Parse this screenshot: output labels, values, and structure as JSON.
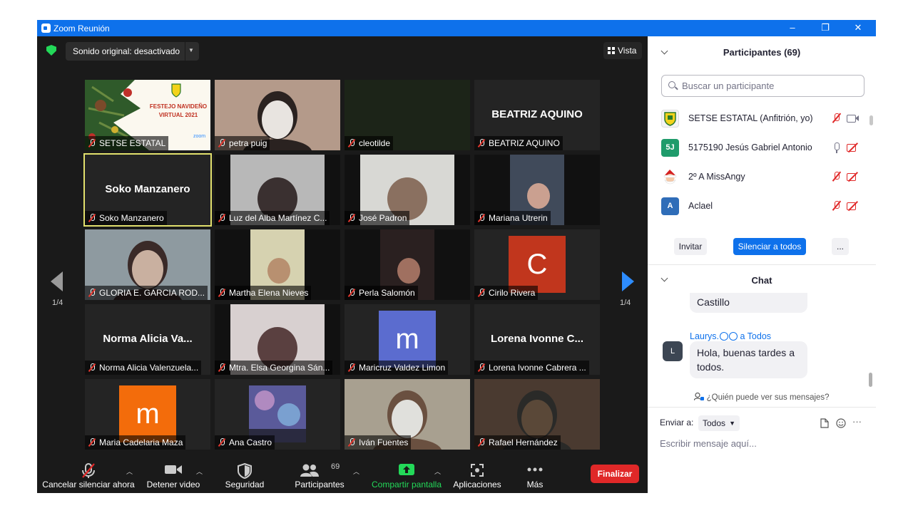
{
  "window": {
    "title": "Zoom Reunión",
    "min": "–",
    "restore": "❐",
    "close": "✕"
  },
  "top": {
    "sound": "Sonido original: desactivado",
    "view": "Vista"
  },
  "pages": {
    "left": "1/4",
    "right": "1/4"
  },
  "tiles": [
    {
      "label": "SETSE ESTATAL",
      "big": ""
    },
    {
      "label": "petra puig",
      "big": ""
    },
    {
      "label": "cleotilde",
      "big": ""
    },
    {
      "label": "BEATRIZ AQUINO",
      "big": "BEATRIZ AQUINO"
    },
    {
      "label": "Soko Manzanero",
      "big": "Soko Manzanero"
    },
    {
      "label": "Luz del Alba Martínez C...",
      "big": ""
    },
    {
      "label": "José Padron",
      "big": ""
    },
    {
      "label": "Mariana Utrerin",
      "big": ""
    },
    {
      "label": "GLORIA E. GARCIA ROD...",
      "big": ""
    },
    {
      "label": "Martha Elena Nieves",
      "big": ""
    },
    {
      "label": "Perla Salomón",
      "big": ""
    },
    {
      "label": "Cirilo Rivera",
      "big": "",
      "letter": "C"
    },
    {
      "label": "Norma Alicia Valenzuela...",
      "big": "Norma Alicia Va..."
    },
    {
      "label": "Mtra. Elsa Georgina Sán...",
      "big": ""
    },
    {
      "label": "Maricruz Valdez Limon",
      "big": "",
      "letter": "m"
    },
    {
      "label": "Lorena Ivonne Cabrera ...",
      "big": "Lorena Ivonne C..."
    },
    {
      "label": "Maria Cadelaria Maza",
      "big": "",
      "letter": "m"
    },
    {
      "label": "Ana Castro",
      "big": ""
    },
    {
      "label": "Iván Fuentes",
      "big": ""
    },
    {
      "label": "Rafael Hernández",
      "big": ""
    }
  ],
  "banner": {
    "line1": "FESTEJO NAVIDEÑO",
    "line2": "VIRTUAL 2021",
    "brand": "zoom"
  },
  "toolbar": {
    "unmute": "Cancelar silenciar ahora",
    "video": "Detener video",
    "security": "Seguridad",
    "participants": "Participantes",
    "participants_count": "69",
    "share": "Compartir pantalla",
    "apps": "Aplicaciones",
    "more": "Más",
    "end": "Finalizar"
  },
  "participants_panel": {
    "title": "Participantes (69)",
    "search_placeholder": "Buscar un participante",
    "list": [
      {
        "name": "SETSE ESTATAL (Anfitrión, yo)",
        "avatar": "",
        "color": "#f4f4f4"
      },
      {
        "name": "5175190 Jesús Gabriel Antonio",
        "avatar": "5J",
        "color": "#1f9b6b"
      },
      {
        "name": "2º A  MissAngy",
        "avatar": "",
        "color": "#ffffff"
      },
      {
        "name": "Aclael",
        "avatar": "A",
        "color": "#2f6db8"
      }
    ],
    "invite": "Invitar",
    "mute_all": "Silenciar a todos",
    "more": "..."
  },
  "chat": {
    "title": "Chat",
    "prev_message_tail": "Castillo",
    "sender": "Laurys.",
    "to": "a Todos",
    "avatar": "L",
    "message": "Hola, buenas tardes a todos.",
    "who_can_see": "¿Quién puede ver sus mensajes?",
    "send_to_label": "Enviar a:",
    "send_to_value": "Todos",
    "input_placeholder": "Escribir mensaje aquí...",
    "more": "···"
  }
}
